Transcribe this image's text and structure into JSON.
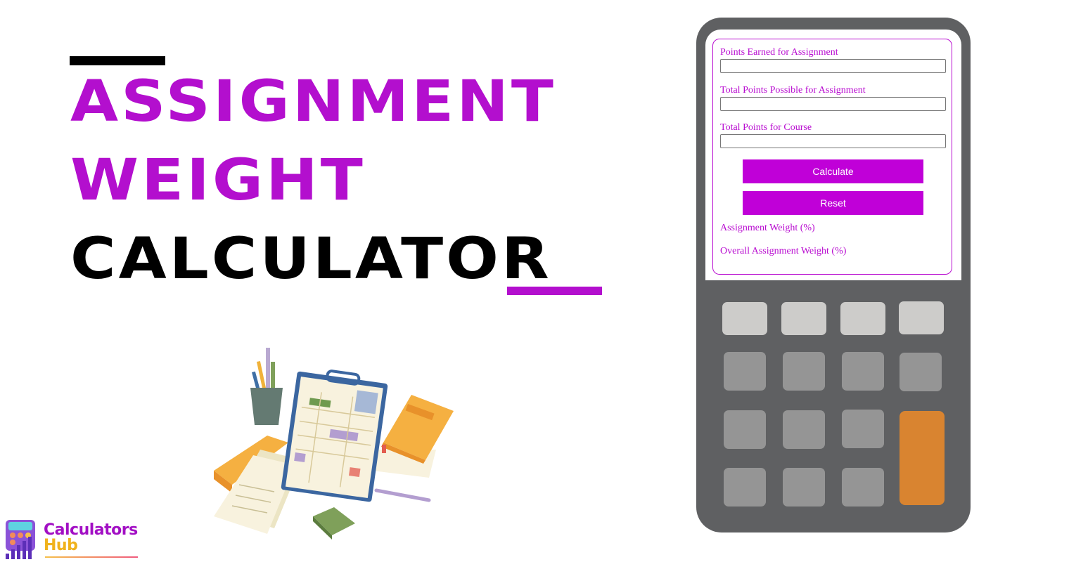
{
  "title": {
    "line1": "ASSIGNMENT",
    "line2": "WEIGHT",
    "line3": "CALCULATOR",
    "accent_color": "#b30fce",
    "text_color": "#000000"
  },
  "calculator": {
    "fields": [
      {
        "label": "Points Earned for Assignment",
        "value": "",
        "placeholder": ""
      },
      {
        "label": "Total Points Possible for Assignment",
        "value": "",
        "placeholder": ""
      },
      {
        "label": "Total Points for Course",
        "value": "",
        "placeholder": ""
      }
    ],
    "buttons": {
      "calculate": "Calculate",
      "reset": "Reset"
    },
    "results": [
      {
        "label": "Assignment Weight (%)"
      },
      {
        "label": "Overall Assignment Weight (%)"
      }
    ],
    "button_color": "#c000d8",
    "body_color": "#5f6062",
    "accent_key_color": "#d98430"
  },
  "illustration": {
    "icon": "clipboard-study-illustration"
  },
  "logo": {
    "line1": "Calculators",
    "line2": "Hub",
    "icon": "calculator-chart-logo-icon"
  }
}
